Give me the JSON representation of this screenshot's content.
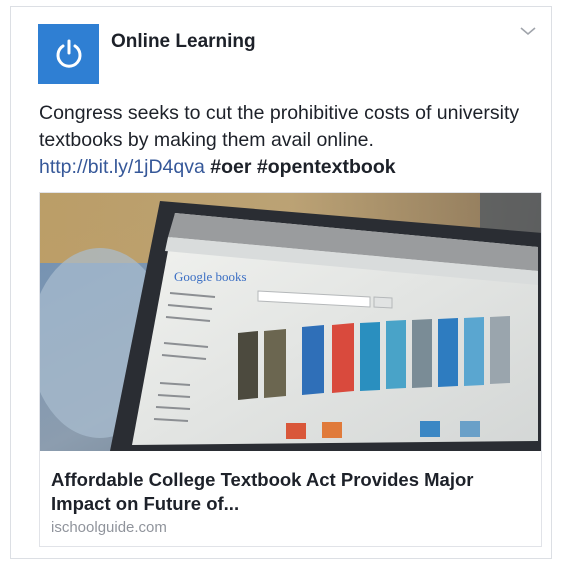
{
  "post": {
    "page_name": "Online Learning",
    "avatar_icon": "power-icon",
    "menu_icon": "chevron-down-icon",
    "text_main": "Congress seeks to cut the prohibitive costs of university textbooks by making them avail online.",
    "link": "http://bit.ly/1jD4qva",
    "hashtags": [
      "#oer",
      "#opentextbook"
    ]
  },
  "preview": {
    "image_alt": "laptop-screen-google-books",
    "screen_logo": "Google books",
    "title": "Affordable College Textbook Act Provides Major Impact on Future of...",
    "domain": "ischoolguide.com"
  },
  "colors": {
    "brand": "#2f7fd3",
    "link": "#365899",
    "muted": "#90949c"
  }
}
